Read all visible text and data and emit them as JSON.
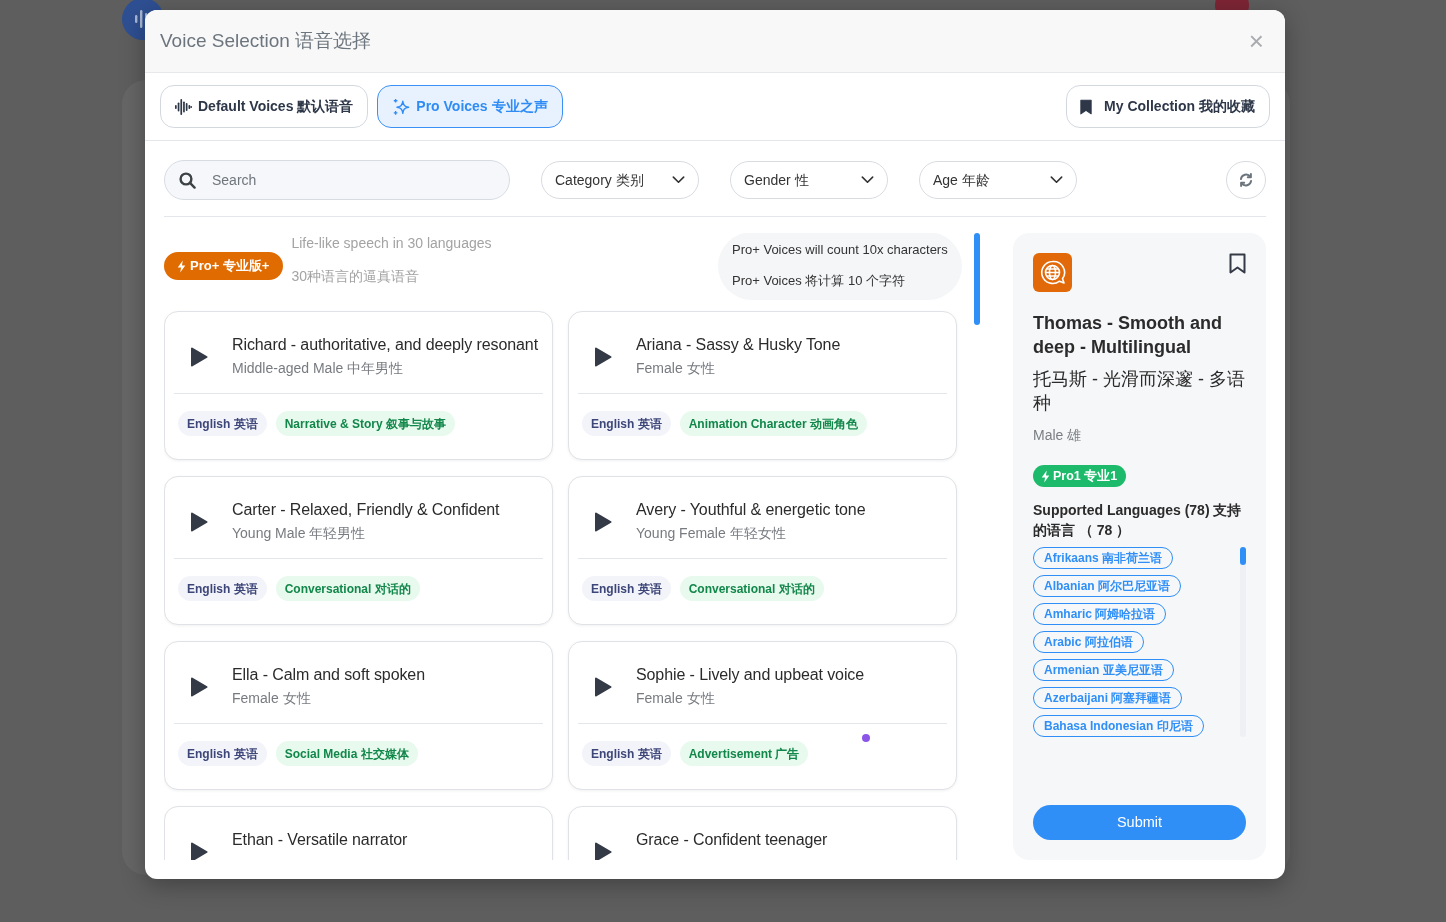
{
  "window": {
    "title": "Voice Selection 语音选择",
    "close": "×"
  },
  "tabs": [
    {
      "kind": "default",
      "label": "Default Voices 默认语音",
      "selected": false
    },
    {
      "kind": "pro",
      "label": "Pro Voices 专业之声",
      "selected": true
    }
  ],
  "collection_button": {
    "label": "My Collection 我的收藏"
  },
  "filters": {
    "search": {
      "placeholder": "Search"
    },
    "dropdowns": [
      {
        "label": "Category 类别"
      },
      {
        "label": "Gender 性"
      },
      {
        "label": "Age 年龄"
      }
    ]
  },
  "plan": {
    "badge": "Pro+ 专业版+",
    "tagline": [
      "Life-like speech in 30 languages",
      "30种语言的逼真语音"
    ],
    "notice": [
      "Pro+ Voices will count 10x characters",
      "Pro+ Voices 将计算 10 个字符"
    ]
  },
  "voices": [
    {
      "name": "Richard - authoritative, and deeply resonant",
      "description": "Middle-aged Male 中年男性",
      "tags": [
        {
          "kind": "language",
          "label": "English 英语"
        },
        {
          "kind": "category",
          "label": "Narrative & Story 叙事与故事"
        }
      ],
      "dot": false
    },
    {
      "name": "Ariana - Sassy & Husky Tone",
      "description": "Female 女性",
      "tags": [
        {
          "kind": "language",
          "label": "English 英语"
        },
        {
          "kind": "category",
          "label": "Animation Character 动画角色"
        }
      ],
      "dot": false
    },
    {
      "name": "Carter - Relaxed, Friendly & Confident",
      "description": "Young Male 年轻男性",
      "tags": [
        {
          "kind": "language",
          "label": "English 英语"
        },
        {
          "kind": "category",
          "label": "Conversational 对话的"
        }
      ],
      "dot": false
    },
    {
      "name": "Avery - Youthful & energetic tone",
      "description": "Young Female 年轻女性",
      "tags": [
        {
          "kind": "language",
          "label": "English 英语"
        },
        {
          "kind": "category",
          "label": "Conversational 对话的"
        }
      ],
      "dot": false
    },
    {
      "name": "Ella - Calm and soft spoken",
      "description": "Female 女性",
      "tags": [
        {
          "kind": "language",
          "label": "English 英语"
        },
        {
          "kind": "category",
          "label": "Social Media 社交媒体"
        }
      ],
      "dot": false
    },
    {
      "name": "Sophie - Lively and upbeat voice",
      "description": "Female 女性",
      "tags": [
        {
          "kind": "language",
          "label": "English 英语"
        },
        {
          "kind": "category",
          "label": "Advertisement 广告"
        }
      ],
      "dot": true
    },
    {
      "name": "Ethan - Versatile narrator",
      "dot": false
    },
    {
      "name": "Grace - Confident teenager",
      "dot": false
    }
  ],
  "selected_voice": {
    "name": "Thomas - Smooth and deep - Multilingual",
    "name_zh": "托马斯 - 光滑而深邃 - 多语种",
    "gender": "Male 雄",
    "bookmarked": false,
    "tier": "Pro1 专业1",
    "languages_heading": "Supported Languages (78) 支持的语言 （ 78 ）",
    "languages": [
      "Afrikaans 南非荷兰语",
      "Albanian 阿尔巴尼亚语",
      "Amharic 阿姆哈拉语",
      "Arabic 阿拉伯语",
      "Armenian 亚美尼亚语",
      "Azerbaijani 阿塞拜疆语",
      "Bahasa Indonesian 印尼语"
    ],
    "submit": "Submit"
  }
}
